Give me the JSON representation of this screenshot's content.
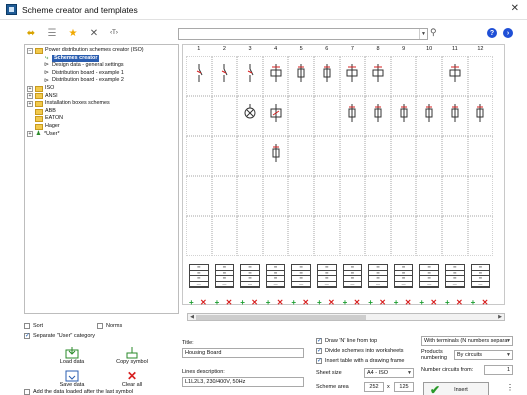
{
  "window": {
    "title": "Scheme creator and templates",
    "close_label": "✕"
  },
  "toolbar": {
    "buttons": [
      {
        "name": "refresh-icon",
        "glyph": "⬌",
        "color": "#d8a300"
      },
      {
        "name": "list-icon",
        "glyph": "☰",
        "color": "#8a8a8a"
      },
      {
        "name": "favorite-star-icon",
        "glyph": "★",
        "color": "#f0a800"
      },
      {
        "name": "delete-icon",
        "glyph": "✕",
        "color": "#555555"
      },
      {
        "name": "text-tool-icon",
        "glyph": "‹T›",
        "color": "#333333"
      }
    ],
    "help_label": "?",
    "next_label": "›"
  },
  "search": {
    "value": ""
  },
  "tree": {
    "items": [
      {
        "label": "Power distribution schemes creator (ISO)",
        "indent": 0,
        "type": "folder",
        "expander": "−"
      },
      {
        "label": "Schemes creator",
        "indent": 1,
        "type": "doc",
        "selected": true
      },
      {
        "label": "Design data - general settings",
        "indent": 1,
        "type": "doc"
      },
      {
        "label": "Distribution board - example 1",
        "indent": 1,
        "type": "doc"
      },
      {
        "label": "Distribution board - example 2",
        "indent": 1,
        "type": "doc"
      },
      {
        "label": "ISO",
        "indent": 0,
        "type": "folder",
        "expander": "+"
      },
      {
        "label": "ANSI",
        "indent": 0,
        "type": "folder",
        "expander": "+"
      },
      {
        "label": "Installation boxes schemes",
        "indent": 0,
        "type": "folder",
        "expander": "+"
      },
      {
        "label": "ABB",
        "indent": 0,
        "type": "folder",
        "expander": ""
      },
      {
        "label": "EATON",
        "indent": 0,
        "type": "folder",
        "expander": ""
      },
      {
        "label": "Hager",
        "indent": 0,
        "type": "folder",
        "expander": ""
      },
      {
        "label": "*User*",
        "indent": 0,
        "type": "user",
        "expander": "+"
      }
    ]
  },
  "grid": {
    "columns": [
      "1",
      "2",
      "3",
      "4",
      "5",
      "6",
      "7",
      "8",
      "9",
      "10",
      "11",
      "12"
    ]
  },
  "options_left": {
    "sort_label": "Sort",
    "norms_label": "Norms",
    "separate_label": "Separate \"User\" category",
    "load_label": "Load data",
    "copy_label": "Copy symbol",
    "save_label": "Save data",
    "clear_label": "Clear all",
    "add_label": "Add the data loaded after the last symbol"
  },
  "form": {
    "title_label": "Title:",
    "title_value": "Housing Board",
    "lines_label": "Lines description:",
    "lines_value": "L1L2L3, 230/400V, 50Hz",
    "draw_n_label": "Draw 'N' line from top",
    "divide_label": "Divide schemes into worksheets",
    "insert_table_label": "Insert table with a drawing frame",
    "sheet_size_label": "Sheet size",
    "sheet_size_value": "A4 - ISO",
    "scheme_area_label": "Scheme area",
    "scheme_area_w": "252",
    "scheme_area_x": "x",
    "scheme_area_h": "125",
    "terminals_value": "With terminals (N numbers separa",
    "products_label": "Products numbering",
    "products_value": "By circuits",
    "number_circuits_label": "Number circuits from:",
    "number_circuits_value": "1",
    "insert_label": "Insert"
  }
}
